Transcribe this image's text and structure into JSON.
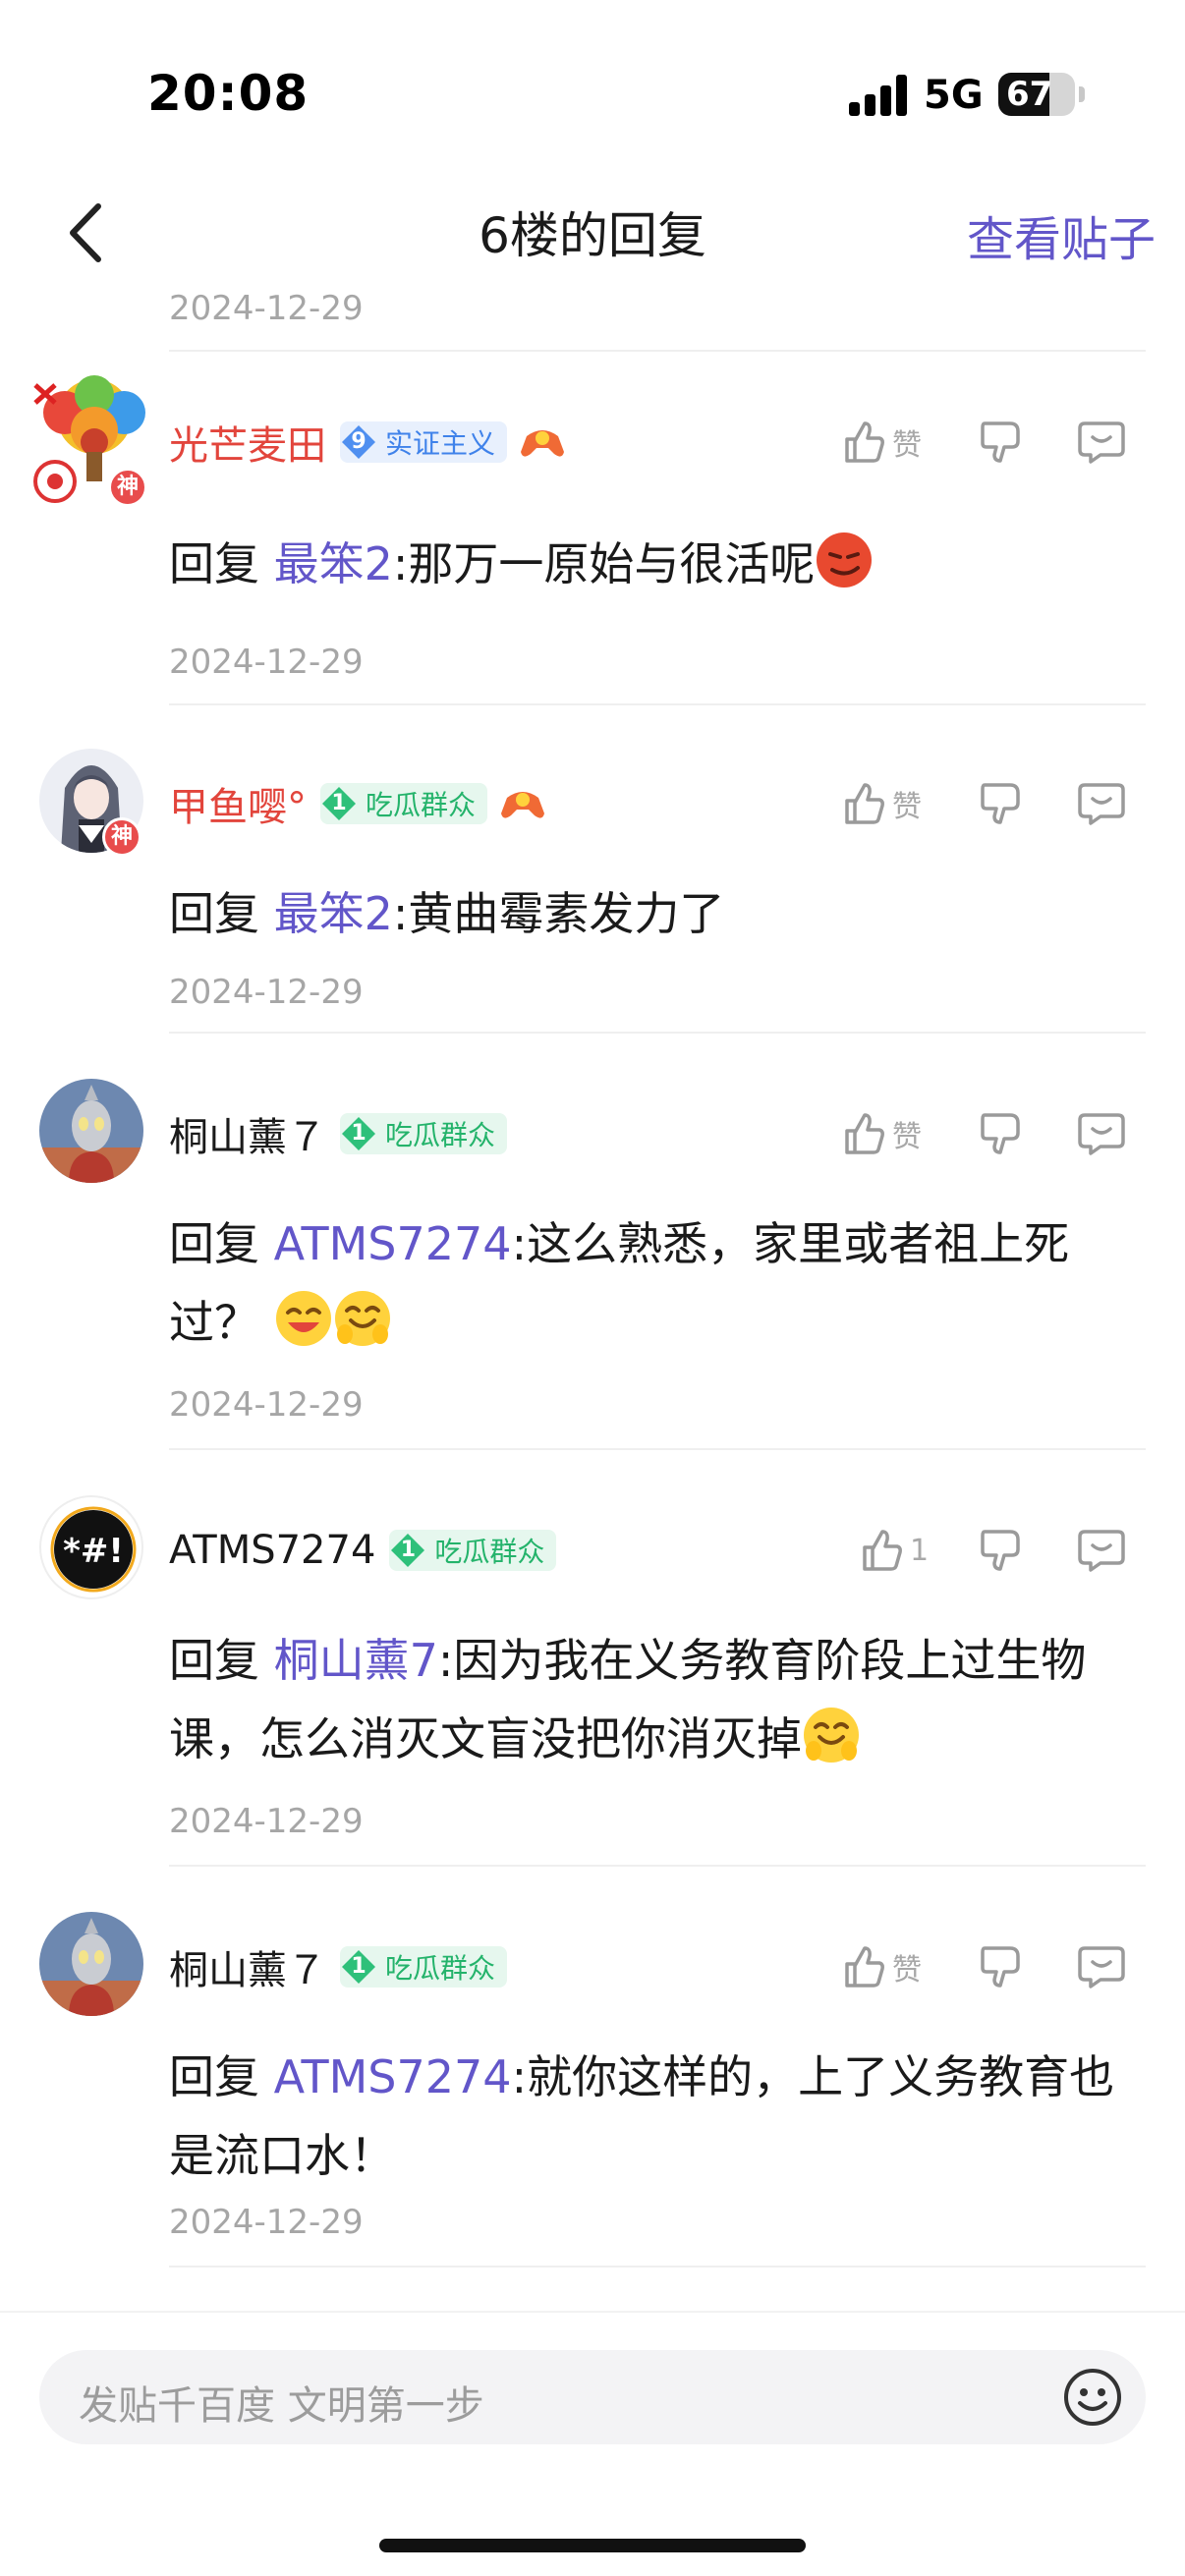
{
  "status_bar": {
    "time": "20:08",
    "network": "5G",
    "battery": "67",
    "battery_level": 0.67
  },
  "nav": {
    "title": "6楼的回复",
    "view_post": "查看贴子",
    "back_icon": "chevron-left-icon"
  },
  "top_date": "2024-12-29",
  "comments": [
    {
      "username": "光芒麦田",
      "username_color": "#e2453c",
      "god_badge": "神",
      "level": "9",
      "title": "实证主义",
      "badge_style": "blue",
      "has_game_icon": true,
      "like_label": "赞",
      "reply_prefix": "回复",
      "mention": "最笨2",
      "text": ":那万一原始与很活呢",
      "date": "2024-12-29"
    },
    {
      "username": "甲鱼嘤°",
      "username_color": "#e2453c",
      "god_badge": "神",
      "level": "1",
      "title": "吃瓜群众",
      "badge_style": "green",
      "has_game_icon": true,
      "like_label": "赞",
      "reply_prefix": "回复",
      "mention": "最笨2",
      "text": ":黄曲霉素发力了",
      "date": "2024-12-29"
    },
    {
      "username": "桐山薰７",
      "level": "1",
      "title": "吃瓜群众",
      "badge_style": "green",
      "like_label": "赞",
      "reply_prefix": "回复",
      "mention": "ATMS7274",
      "text": ":这么熟悉，家里或者祖上死过？",
      "date": "2024-12-29"
    },
    {
      "username": "ATMS7274",
      "level": "1",
      "title": "吃瓜群众",
      "badge_style": "green",
      "like_label": "1",
      "reply_prefix": "回复",
      "mention": "桐山薰7",
      "text": ":因为我在义务教育阶段上过生物课，怎么消灭文盲没把你消灭掉",
      "date": "2024-12-29"
    },
    {
      "username": "桐山薰７",
      "level": "1",
      "title": "吃瓜群众",
      "badge_style": "green",
      "like_label": "赞",
      "reply_prefix": "回复",
      "mention": "ATMS7274",
      "text": ":就你这样的，上了义务教育也是流口水！",
      "date": "2024-12-29"
    }
  ],
  "composer": {
    "placeholder": "发贴千百度 文明第一步",
    "emoji_icon": "smiley-icon"
  },
  "colors": {
    "accent": "#6256c9",
    "god_red": "#e2453c",
    "badge_green": "#24b36b",
    "badge_blue": "#3f82ea"
  }
}
